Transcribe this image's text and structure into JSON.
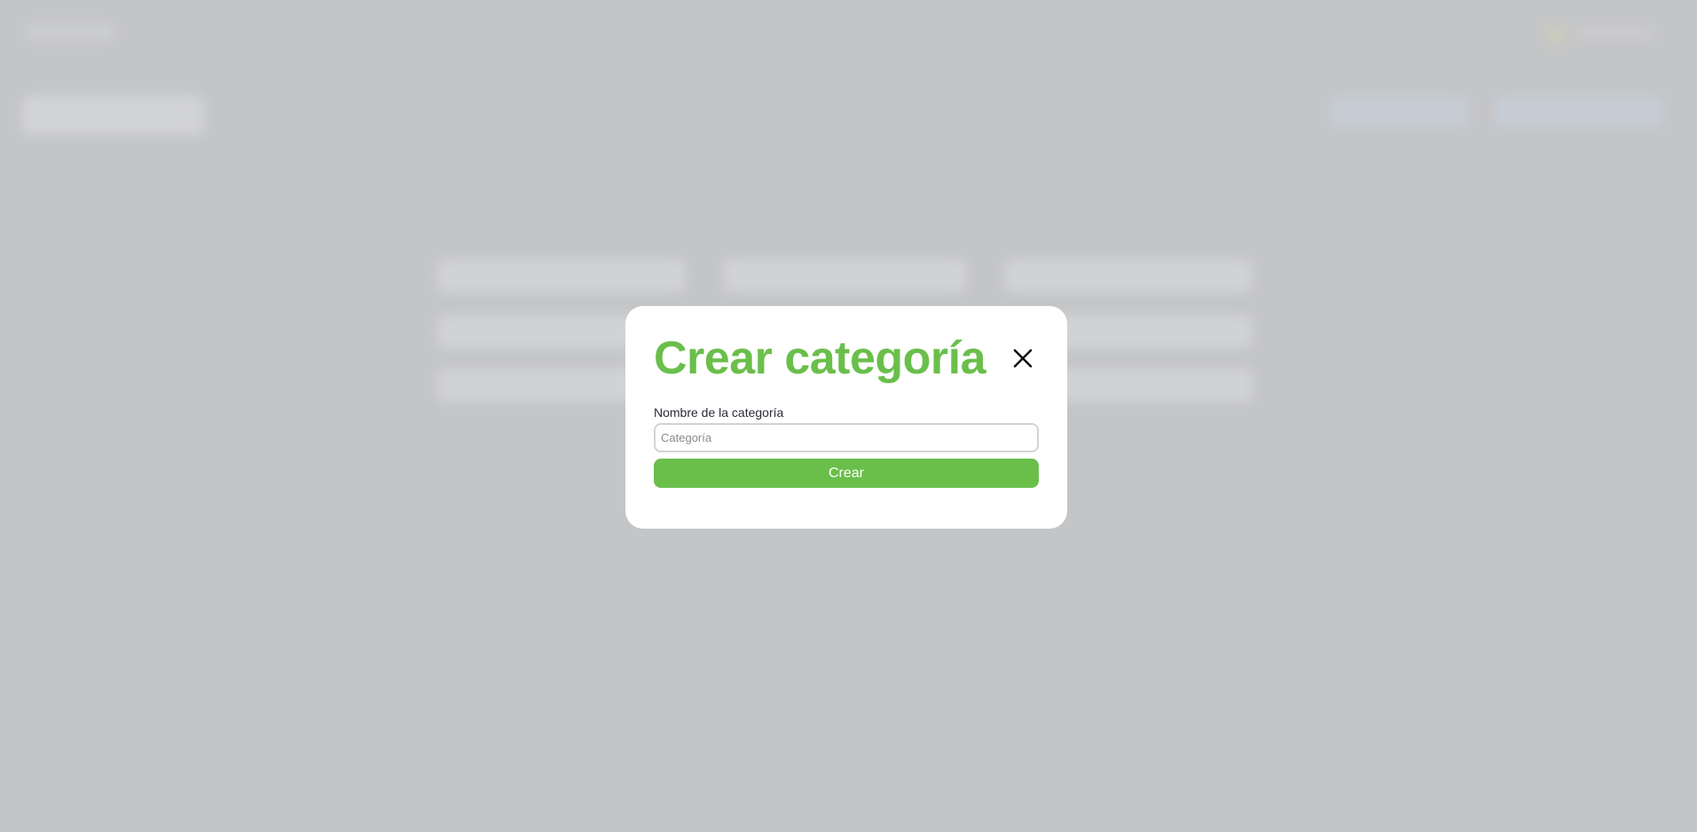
{
  "modal": {
    "title": "Crear categoría",
    "close_icon": "close-icon",
    "field_label": "Nombre de la categoría",
    "input_value": "",
    "input_placeholder": "Categoría",
    "submit_label": "Crear"
  },
  "colors": {
    "accent": "#6abf4b",
    "overlay": "#c4c5c7",
    "modal_bg": "#ffffff"
  }
}
